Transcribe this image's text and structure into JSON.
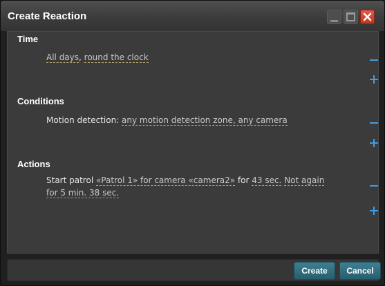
{
  "window": {
    "title": "Create Reaction"
  },
  "time": {
    "heading": "Time",
    "days": "All days",
    "separator": ",",
    "hours": "round the clock"
  },
  "conditions": {
    "heading": "Conditions",
    "prefix": "Motion detection: ",
    "value": "any motion detection zone, any camera"
  },
  "actions": {
    "heading": "Actions",
    "prefix": "Start patrol ",
    "patrol": "«Patrol 1» for camera «camera2»",
    "for_word": " for ",
    "duration": "43 sec.",
    "repeat_a": "Not again",
    "repeat_b": "for 5 min. 38 sec."
  },
  "buttons": {
    "create": "Create",
    "cancel": "Cancel"
  },
  "colors": {
    "accent": "#3aa0ea",
    "close": "#d0432e",
    "button": "#34707f"
  }
}
